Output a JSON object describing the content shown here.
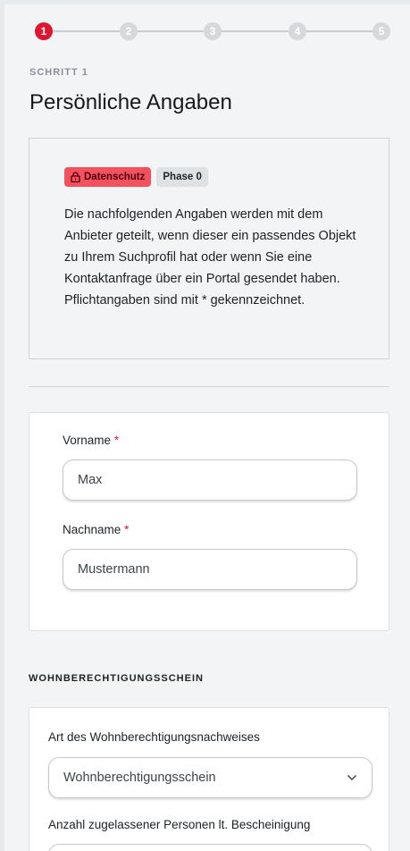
{
  "stepper": {
    "steps": [
      "1",
      "2",
      "3",
      "4",
      "5"
    ],
    "active_step": 1
  },
  "step_label": "SCHRITT 1",
  "page_title": "Persönliche Angaben",
  "info": {
    "badge_privacy": "Datenschutz",
    "badge_phase": "Phase 0",
    "text": "Die nachfolgenden Angaben werden mit dem Anbieter geteilt, wenn dieser ein passendes Objekt zu Ihrem Suchprofil hat oder wenn Sie eine Kontaktanfrage über ein Portal gesendet haben. Pflichtangaben sind mit * gekennzeichnet."
  },
  "form": {
    "firstname_label": "Vorname",
    "firstname_value": "Max",
    "lastname_label": "Nachname",
    "lastname_value": "Mustermann",
    "required_marker": "*"
  },
  "wbs": {
    "heading": "WOHNBERECHTIGUNGSSCHEIN",
    "type_label": "Art des Wohnberechtigungsnachweises",
    "type_value": "Wohnberechtigungsschein",
    "persons_label": "Anzahl zugelassener Personen lt. Bescheinigung"
  },
  "colors": {
    "accent": "#dd1730",
    "privacy_badge": "#f4515f",
    "background": "#f2f4f6"
  },
  "icons": {
    "privacy_badge_icon": "lock-icon",
    "select_icon": "chevron-down-icon"
  }
}
